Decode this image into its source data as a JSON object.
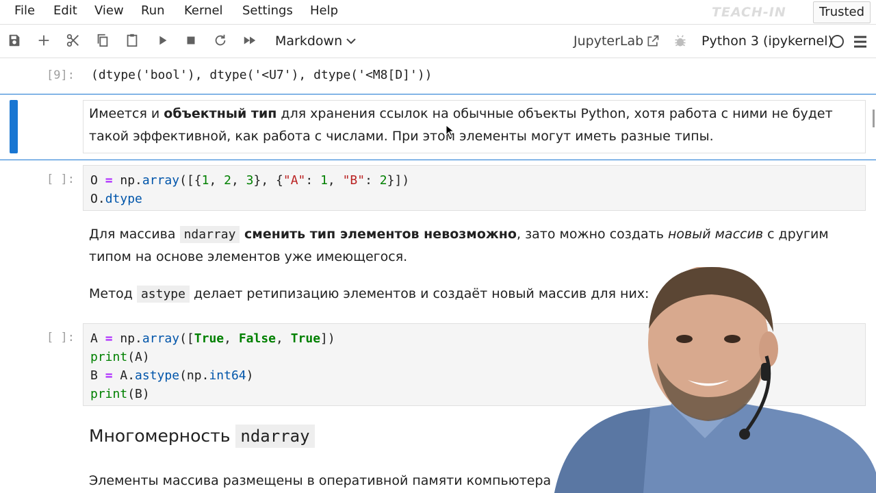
{
  "menubar": {
    "items": [
      "File",
      "Edit",
      "View",
      "Run",
      "Kernel",
      "Settings",
      "Help"
    ],
    "watermark": "TEACH-IN",
    "trusted_label": "Trusted"
  },
  "toolbar": {
    "cell_type": "Markdown",
    "jupyterlab_label": "JupyterLab",
    "kernel_name": "Python 3 (ipykernel)"
  },
  "cells": {
    "output_prompt": "[9]:",
    "output_text": "(dtype('bool'), dtype('<U7'), dtype('<M8[D]'))",
    "md1": {
      "pre": "Имеется и ",
      "bold": "объектный тип",
      "post": " для хранения ссылок на обычные объекты Python, хотя работа с ними не будет такой эффективной, как работа с числами. При этом элементы могут иметь разные типы."
    },
    "code1_prompt": "[ ]:",
    "md2": {
      "pre": "Для массива ",
      "code": "ndarray",
      "bold": " сменить тип элементов невозможно",
      "mid": ", зато можно создать ",
      "italic": "новый массив",
      "post": " с другим типом на основе элементов уже имеющегося."
    },
    "md3": {
      "pre": "Метод ",
      "code": "astype",
      "post": " делает ретипизацию элементов и создаёт новый массив для них:"
    },
    "code2_prompt": "[ ]:",
    "heading": {
      "text": "Многомерность ",
      "code": "ndarray"
    },
    "md4": "Элементы массива размещены в оперативной памяти компьютера"
  }
}
